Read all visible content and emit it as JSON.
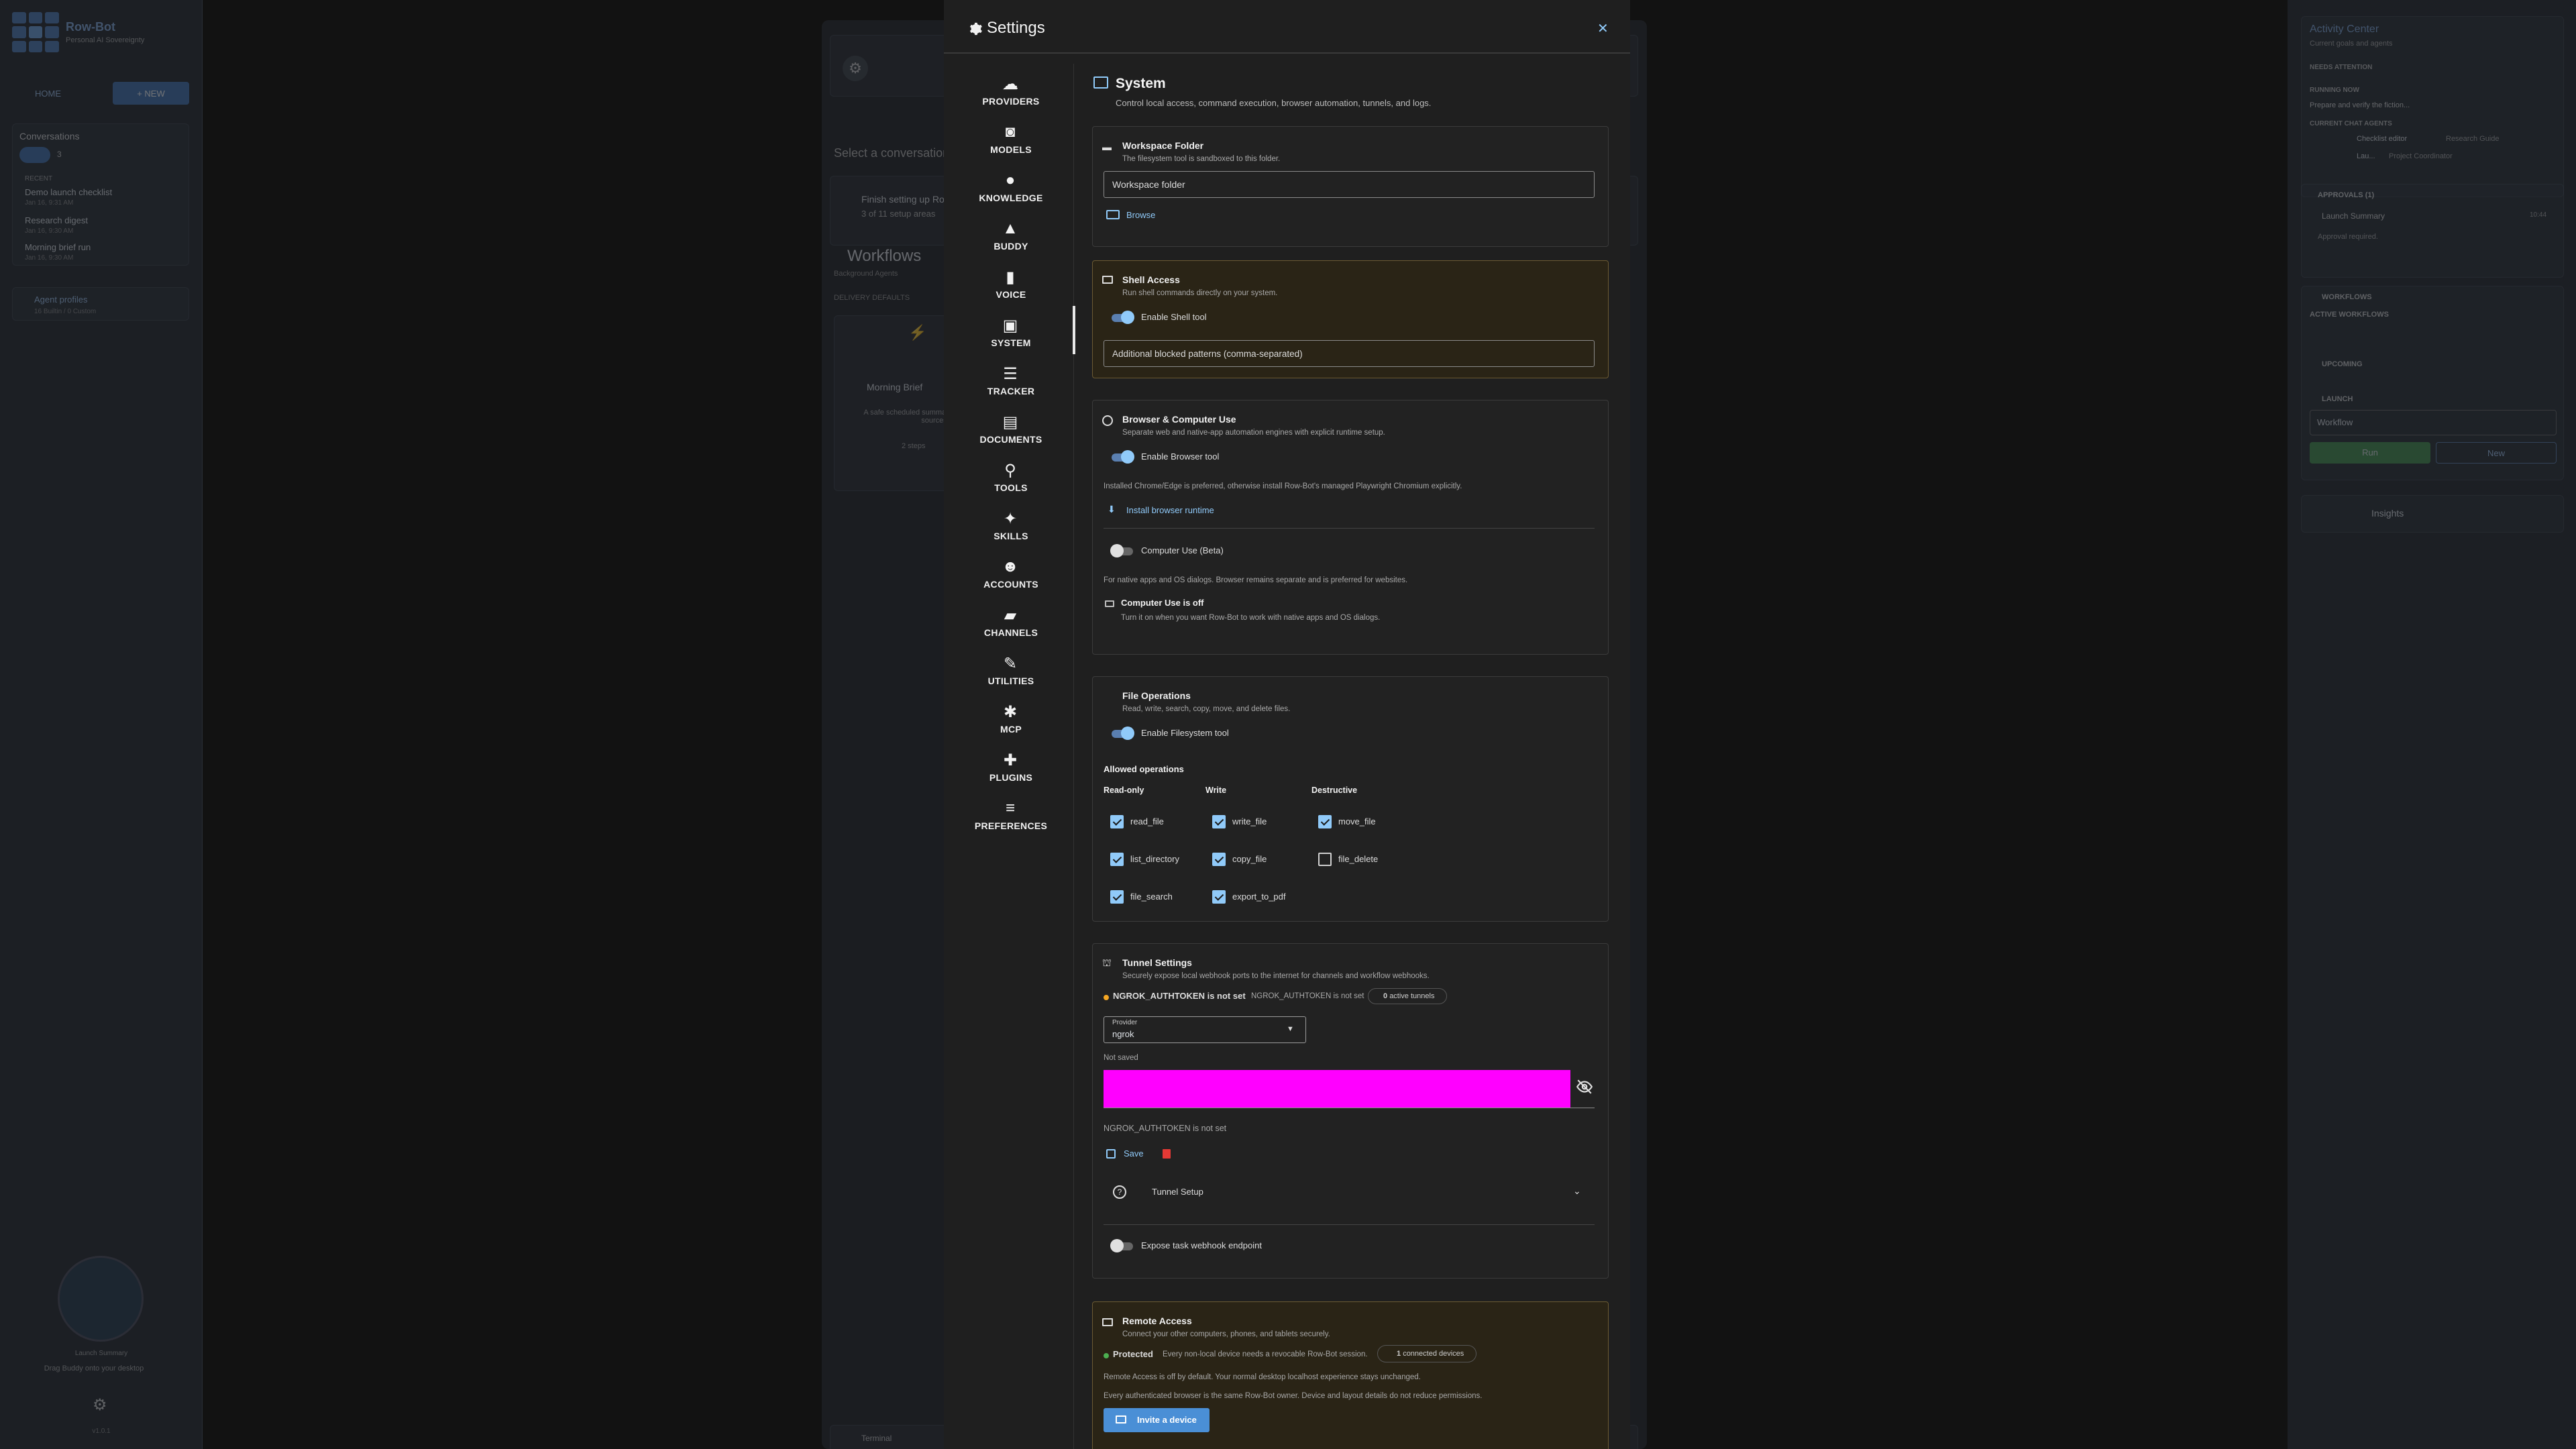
{
  "app": {
    "name": "Row-Bot",
    "tagline": "Personal AI Sovereignty",
    "home": "HOME",
    "new": "+ NEW"
  },
  "left": {
    "conversations_title": "Conversations",
    "recent": "RECENT",
    "conv_count": "3",
    "items": [
      {
        "title": "Demo launch checklist",
        "date": "Jan 16, 9:31 AM"
      },
      {
        "title": "Research digest",
        "date": "Jan 16, 9:30 AM"
      },
      {
        "title": "Morning brief run",
        "date": "Jan 16, 9:30 AM"
      }
    ],
    "agent_profiles": "Agent profiles",
    "agent_profiles_sub": "16 Builtin / 0 Custom",
    "buddy_label": "Launch Summary",
    "buddy_hint": "Drag Buddy onto your desktop",
    "version": "v1.0.1"
  },
  "center": {
    "select": "Select a conversation",
    "setup_title": "Finish setting up Row-Bot",
    "setup_sub": "3 of 11 setup areas",
    "workflows": "Workflows",
    "workflows_sub": "Background Agents",
    "delivery": "DELIVERY DEFAULTS",
    "card_title": "Morning Brief",
    "card_desc": "A safe scheduled summary from local demo sources.",
    "card_steps": "2 steps",
    "terminal": "Terminal"
  },
  "right": {
    "title": "Activity Center",
    "subtitle": "Current goals and agents",
    "needs": "NEEDS ATTENTION",
    "running": "RUNNING NOW",
    "running_item": "Prepare and verify the fiction...",
    "current": "CURRENT CHAT AGENTS",
    "agent1": "Checklist editor",
    "agent1_role": "Research Guide",
    "agent2": "Lau...",
    "agent2_role": "Project Coordinator",
    "approvals": "APPROVALS (1)",
    "approval_title": "Launch Summary",
    "approval_sub": "Approval required.",
    "approval_time": "10:44",
    "workflows": "WORKFLOWS",
    "active_workflows": "ACTIVE WORKFLOWS",
    "upcoming": "UPCOMING",
    "launch": "LAUNCH",
    "workflow_select": "Workflow",
    "run": "Run",
    "new": "New",
    "insights": "Insights"
  },
  "settings": {
    "title": "Settings",
    "nav": [
      "PROVIDERS",
      "MODELS",
      "KNOWLEDGE",
      "BUDDY",
      "VOICE",
      "SYSTEM",
      "TRACKER",
      "DOCUMENTS",
      "TOOLS",
      "SKILLS",
      "ACCOUNTS",
      "CHANNELS",
      "UTILITIES",
      "MCP",
      "PLUGINS",
      "PREFERENCES"
    ],
    "system_title": "System",
    "system_desc": "Control local access, command execution, browser automation, tunnels, and logs.",
    "workspace": {
      "title": "Workspace Folder",
      "desc": "The filesystem tool is sandboxed to this folder.",
      "placeholder": "Workspace folder",
      "browse": "Browse"
    },
    "shell": {
      "title": "Shell Access",
      "desc": "Run shell commands directly on your system.",
      "toggle": "Enable Shell tool",
      "blocked": "Additional blocked patterns (comma-separated)"
    },
    "browser": {
      "title": "Browser & Computer Use",
      "desc": "Separate web and native-app automation engines with explicit runtime setup.",
      "toggle": "Enable Browser tool",
      "note": "Installed Chrome/Edge is preferred, otherwise install Row-Bot's managed Playwright Chromium explicitly.",
      "install": "Install browser runtime",
      "cu_toggle": "Computer Use (Beta)",
      "cu_note": "For native apps and OS dialogs. Browser remains separate and is preferred for websites.",
      "cu_off": "Computer Use is off",
      "cu_off_desc": "Turn it on when you want Row-Bot to work with native apps and OS dialogs."
    },
    "files": {
      "title": "File Operations",
      "desc": "Read, write, search, copy, move, and delete files.",
      "toggle": "Enable Filesystem tool",
      "allowed": "Allowed operations",
      "readonly": "Read-only",
      "write": "Write",
      "destructive": "Destructive",
      "ops": [
        {
          "label": "read_file",
          "checked": true
        },
        {
          "label": "list_directory",
          "checked": true
        },
        {
          "label": "file_search",
          "checked": true
        },
        {
          "label": "write_file",
          "checked": true
        },
        {
          "label": "copy_file",
          "checked": true
        },
        {
          "label": "export_to_pdf",
          "checked": true
        },
        {
          "label": "move_file",
          "checked": true
        },
        {
          "label": "file_delete",
          "checked": false
        }
      ]
    },
    "tunnel": {
      "title": "Tunnel Settings",
      "desc": "Securely expose local webhook ports to the internet for channels and workflow webhooks.",
      "status": "NGROK_AUTHTOKEN is not set",
      "status_small": "NGROK_AUTHTOKEN is not set",
      "active": "0",
      "active_label": "active tunnels",
      "provider_label": "Provider",
      "provider": "ngrok",
      "not_saved": "Not saved",
      "token_note": "NGROK_AUTHTOKEN is not set",
      "save": "Save",
      "setup": "Tunnel Setup",
      "expose": "Expose task webhook endpoint",
      "secret_color": "#ff00ff"
    },
    "remote": {
      "title": "Remote Access",
      "desc": "Connect your other computers, phones, and tablets securely.",
      "protected": "Protected",
      "protected_desc": "Every non-local device needs a revocable Row-Bot session.",
      "devices": "1",
      "devices_label": "connected devices",
      "off_note": "Remote Access is off by default. Your normal desktop localhost experience stays unchanged.",
      "owner_note": "Every authenticated browser is the same Row-Bot owner. Device and layout details do not reduce permissions.",
      "invite": "Invite a device"
    }
  }
}
